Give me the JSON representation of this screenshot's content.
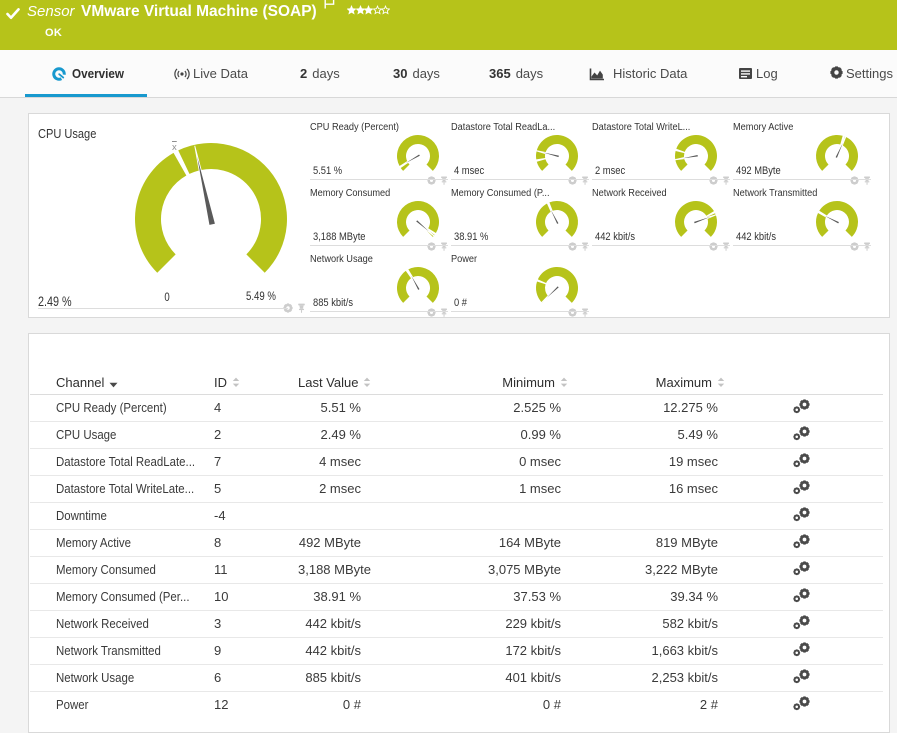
{
  "theme": {
    "status_green": "#b6c31a",
    "tab_blue": "#1899ce",
    "needle_gray": "#5a5a5a",
    "icon_gray": "#cdcdcd",
    "dark_icon": "#444444"
  },
  "header": {
    "kind": "Sensor",
    "title": "VMware Virtual Machine (SOAP)",
    "status": "OK",
    "rating": {
      "filled": 3,
      "total": 5
    }
  },
  "tabs": [
    {
      "id": "overview",
      "label": "Overview",
      "icon": "gauge-icon",
      "active": true
    },
    {
      "id": "live-data",
      "label": "Live Data",
      "icon": "broadcast-icon"
    },
    {
      "id": "2-days",
      "num": "2",
      "label": "days"
    },
    {
      "id": "30-days",
      "num": "30",
      "label": "days"
    },
    {
      "id": "365-days",
      "num": "365",
      "label": "days"
    },
    {
      "id": "historic-data",
      "label": "Historic Data",
      "icon": "area-chart-icon"
    },
    {
      "id": "log",
      "label": "Log",
      "icon": "log-icon"
    },
    {
      "id": "settings",
      "label": "Settings",
      "icon": "gear-icon"
    }
  ],
  "big_gauge": {
    "title": "CPU Usage",
    "value": "2.49 %",
    "scale_min": "0",
    "scale_max": "5.49 %",
    "needle_frac": 0.4536,
    "avg_frac": 0.398,
    "avg_marker": "x"
  },
  "gauges": [
    {
      "title": "CPU Ready (Percent)",
      "value": "5.51 %",
      "needle_frac": 0.055,
      "avg_frac": 0.05
    },
    {
      "title": "Datastore Total ReadLa...",
      "value": "4 msec",
      "needle_frac": 0.22,
      "avg_frac": 0.12
    },
    {
      "title": "Datastore Total WriteL...",
      "value": "2 msec",
      "needle_frac": 0.13,
      "avg_frac": 0.23
    },
    {
      "title": "Memory Active",
      "value": "492 MByte",
      "needle_frac": 0.59,
      "avg_frac": 0.57
    },
    {
      "title": "Memory Consumed",
      "value": "3,188 MByte",
      "needle_frac": 0.985,
      "avg_frac": 0.962
    },
    {
      "title": "Memory Consumed (P...",
      "value": "38.91 %",
      "needle_frac": 0.4,
      "avg_frac": 0.41
    },
    {
      "title": "Network Received",
      "value": "442 kbit/s",
      "needle_frac": 0.76,
      "avg_frac": 0.73
    },
    {
      "title": "Network Transmitted",
      "value": "442 kbit/s",
      "needle_frac": 0.266,
      "avg_frac": 0.275
    },
    {
      "title": "Network Usage",
      "value": "885 kbit/s",
      "needle_frac": 0.393,
      "avg_frac": 0.38
    },
    {
      "title": "Power",
      "value": "0 #",
      "needle_frac": 0.005,
      "avg_frac": 0.245
    }
  ],
  "table": {
    "columns": [
      {
        "key": "channel",
        "label": "Channel",
        "sort": "desc"
      },
      {
        "key": "id",
        "label": "ID",
        "sort": "both"
      },
      {
        "key": "last",
        "label": "Last Value",
        "sort": "both"
      },
      {
        "key": "min",
        "label": "Minimum",
        "sort": "both"
      },
      {
        "key": "max",
        "label": "Maximum",
        "sort": "both"
      }
    ],
    "rows": [
      {
        "channel": "CPU Ready (Percent)",
        "id": "4",
        "last": "5.51 %",
        "min": "2.525 %",
        "max": "12.275 %"
      },
      {
        "channel": "CPU Usage",
        "id": "2",
        "last": "2.49 %",
        "min": "0.99 %",
        "max": "5.49 %"
      },
      {
        "channel": "Datastore Total ReadLate...",
        "id": "7",
        "last": "4 msec",
        "min": "0 msec",
        "max": "19 msec"
      },
      {
        "channel": "Datastore Total WriteLate...",
        "id": "5",
        "last": "2 msec",
        "min": "1 msec",
        "max": "16 msec"
      },
      {
        "channel": "Downtime",
        "id": "-4",
        "last": "",
        "min": "",
        "max": ""
      },
      {
        "channel": "Memory Active",
        "id": "8",
        "last": "492 MByte",
        "min": "164 MByte",
        "max": "819 MByte"
      },
      {
        "channel": "Memory Consumed",
        "id": "11",
        "last": "3,188 MByte",
        "min": "3,075 MByte",
        "max": "3,222 MByte"
      },
      {
        "channel": "Memory Consumed (Per...",
        "id": "10",
        "last": "38.91 %",
        "min": "37.53 %",
        "max": "39.34 %"
      },
      {
        "channel": "Network Received",
        "id": "3",
        "last": "442 kbit/s",
        "min": "229 kbit/s",
        "max": "582 kbit/s"
      },
      {
        "channel": "Network Transmitted",
        "id": "9",
        "last": "442 kbit/s",
        "min": "172 kbit/s",
        "max": "1,663 kbit/s"
      },
      {
        "channel": "Network Usage",
        "id": "6",
        "last": "885 kbit/s",
        "min": "401 kbit/s",
        "max": "2,253 kbit/s"
      },
      {
        "channel": "Power",
        "id": "12",
        "last": "0 #",
        "min": "0 #",
        "max": "2 #"
      }
    ]
  }
}
